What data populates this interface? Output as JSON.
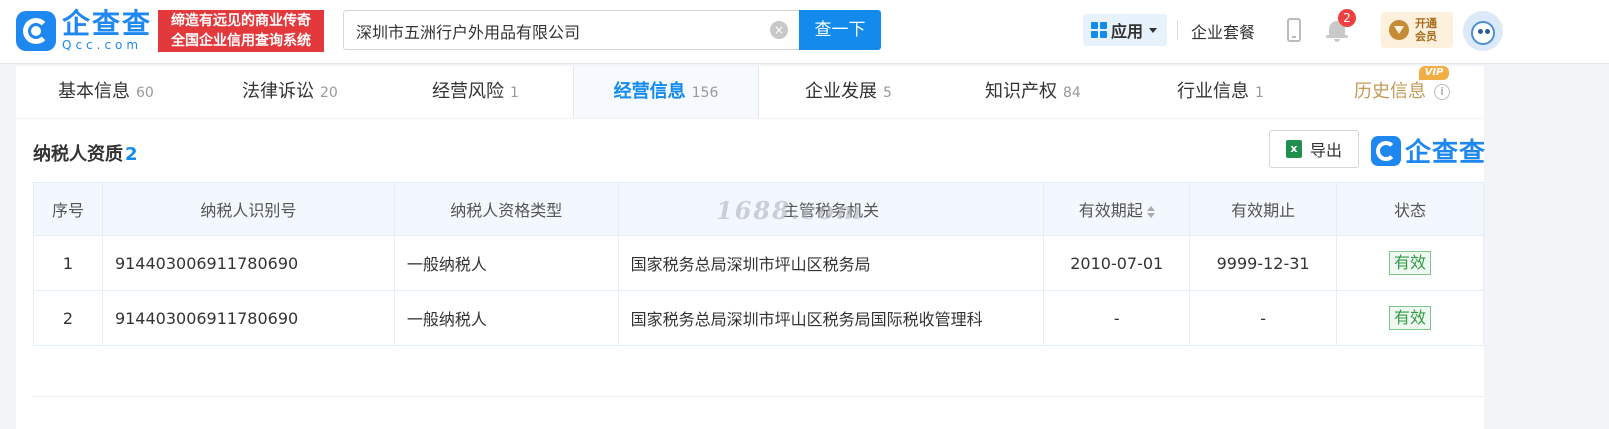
{
  "header": {
    "logo_cn": "企查查",
    "logo_en": "Qcc.com",
    "slogan_line1": "缔造有远见的商业传奇",
    "slogan_line2": "全国企业信用查询系统",
    "search_value": "深圳市五洲行户外用品有限公司",
    "search_button": "查一下",
    "clear_icon": "×",
    "app_label": "应用",
    "package_link": "企业套餐",
    "notification_count": "2",
    "vip_line1": "开通",
    "vip_line2": "会员"
  },
  "tabs": [
    {
      "label": "基本信息",
      "count": "60"
    },
    {
      "label": "法律诉讼",
      "count": "20"
    },
    {
      "label": "经营风险",
      "count": "1"
    },
    {
      "label": "经营信息",
      "count": "156"
    },
    {
      "label": "企业发展",
      "count": "5"
    },
    {
      "label": "知识产权",
      "count": "84"
    },
    {
      "label": "行业信息",
      "count": "1"
    },
    {
      "label": "历史信息",
      "count": ""
    }
  ],
  "vip_tag": "VIP",
  "info_icon": "i",
  "section": {
    "title": "纳税人资质",
    "count": "2",
    "export_label": "导出",
    "excel_icon_text": "x",
    "brand_text": "企查查"
  },
  "watermark": "1688.com",
  "table": {
    "headers": [
      "序号",
      "纳税人识别号",
      "纳税人资格类型",
      "主管税务机关",
      "有效期起",
      "有效期止",
      "状态"
    ],
    "rows": [
      {
        "idx": "1",
        "tax_id": "914403006911780690",
        "type": "一般纳税人",
        "authority": "国家税务总局深圳市坪山区税务局",
        "start": "2010-07-01",
        "end": "9999-12-31",
        "status": "有效"
      },
      {
        "idx": "2",
        "tax_id": "914403006911780690",
        "type": "一般纳税人",
        "authority": "国家税务总局深圳市坪山区税务局国际税收管理科",
        "start": "-",
        "end": "-",
        "status": "有效"
      }
    ]
  },
  "colors": {
    "accent": "#128bed",
    "slogan_bg": "#e4393c",
    "status_green": "#2f9b45",
    "history_gold": "#c59a57"
  }
}
